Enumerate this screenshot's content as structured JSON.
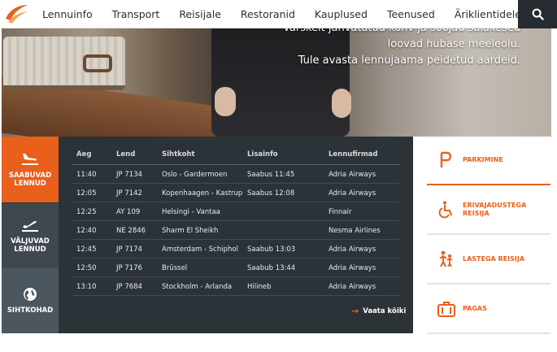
{
  "nav": {
    "items": [
      "Lennuinfo",
      "Transport",
      "Reisijale",
      "Restoranid",
      "Kauplused",
      "Teenused",
      "Äriklientidele"
    ],
    "search_icon": "search-icon"
  },
  "hero": {
    "line1": "Värskelt jahvatatud kohv ja soojad saiakesed",
    "line2": "loovad hubase meeleolu.",
    "line3": "Tule avasta lennujaama peidetud aardeid."
  },
  "tabs": [
    {
      "label": "SAABUVAD LENNUD",
      "icon": "arrival-plane-icon"
    },
    {
      "label": "VÄLJUVAD LENNUD",
      "icon": "departure-plane-icon"
    },
    {
      "label": "SIHTKOHAD",
      "icon": "globe-icon"
    }
  ],
  "flights": {
    "headers": [
      "Aeg",
      "Lend",
      "Sihtkoht",
      "Lisainfo",
      "Lennufirmad"
    ],
    "rows": [
      {
        "time": "11:40",
        "flight": "JP 7134",
        "destination": "Oslo - Gardermoen",
        "info": "Saabus 11:45",
        "airline": "Adria Airways"
      },
      {
        "time": "12:05",
        "flight": "JP 7142",
        "destination": "Kopenhaagen - Kastrup",
        "info": "Saabus 12:08",
        "airline": "Adria Airways"
      },
      {
        "time": "12:25",
        "flight": "AY 109",
        "destination": "Helsingi - Vantaa",
        "info": "",
        "airline": "Finnair"
      },
      {
        "time": "12:40",
        "flight": "NE 2846",
        "destination": "Sharm El Sheikh",
        "info": "",
        "airline": "Nesma Airlines"
      },
      {
        "time": "12:45",
        "flight": "JP 7174",
        "destination": "Amsterdam - Schiphol",
        "info": "Saabub 13:03",
        "airline": "Adria Airways"
      },
      {
        "time": "12:50",
        "flight": "JP 7176",
        "destination": "Brüssel",
        "info": "Saabub 13:44",
        "airline": "Adria Airways"
      },
      {
        "time": "13:10",
        "flight": "JP 7684",
        "destination": "Stockholm - Arlanda",
        "info": "Hilineb",
        "airline": "Adria Airways"
      }
    ],
    "view_all": "Vaata kõiki"
  },
  "quick_links": [
    {
      "label": "PARKIMINE",
      "icon": "parking-icon"
    },
    {
      "label": "ERIVAJADUSTEGA REISIJA",
      "icon": "wheelchair-icon"
    },
    {
      "label": "LASTEGA REISIJA",
      "icon": "family-icon"
    },
    {
      "label": "PAGAS",
      "icon": "luggage-icon"
    }
  ],
  "colors": {
    "accent": "#e8601c",
    "dark": "#2b3238",
    "nav_dark": "#252b30"
  }
}
